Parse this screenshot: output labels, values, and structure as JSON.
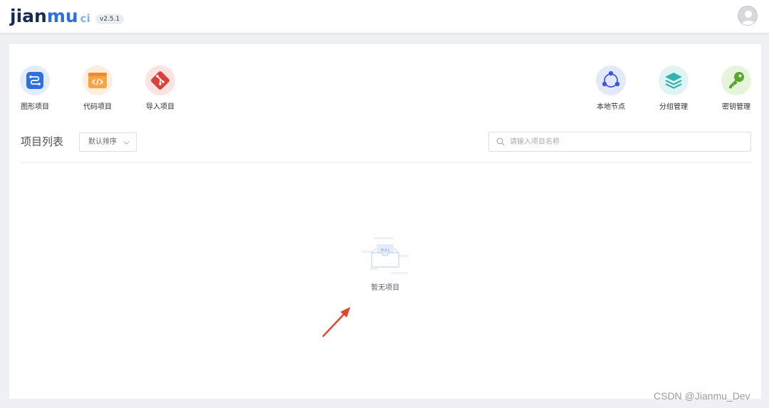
{
  "header": {
    "logo_main": "jian",
    "logo_mu": "mu",
    "logo_ci": "ci",
    "version": "v2.5.1"
  },
  "shortcuts_left": [
    {
      "label": "图形项目",
      "icon": "graph-project-icon",
      "color": "#2f6fe0",
      "bg": "#e3ecfc"
    },
    {
      "label": "代码项目",
      "icon": "code-project-icon",
      "color": "#f0953a",
      "bg": "#fdeede"
    },
    {
      "label": "导入项目",
      "icon": "git-import-icon",
      "color": "#d9423a",
      "bg": "#fbe3e1"
    }
  ],
  "shortcuts_right": [
    {
      "label": "本地节点",
      "icon": "local-node-icon",
      "color": "#3a5cd6",
      "bg": "#e3e8fb"
    },
    {
      "label": "分组管理",
      "icon": "group-layers-icon",
      "color": "#36b3b0",
      "bg": "#dff4f3"
    },
    {
      "label": "密钥管理",
      "icon": "key-icon",
      "color": "#5aa830",
      "bg": "#e6f4dc"
    }
  ],
  "project_list": {
    "title": "项目列表",
    "sort_label": "默认排序",
    "search_placeholder": "请输入项目名称",
    "empty_badge": "NULL",
    "empty_text": "暂无项目"
  },
  "watermark": "CSDN @Jianmu_Dev"
}
